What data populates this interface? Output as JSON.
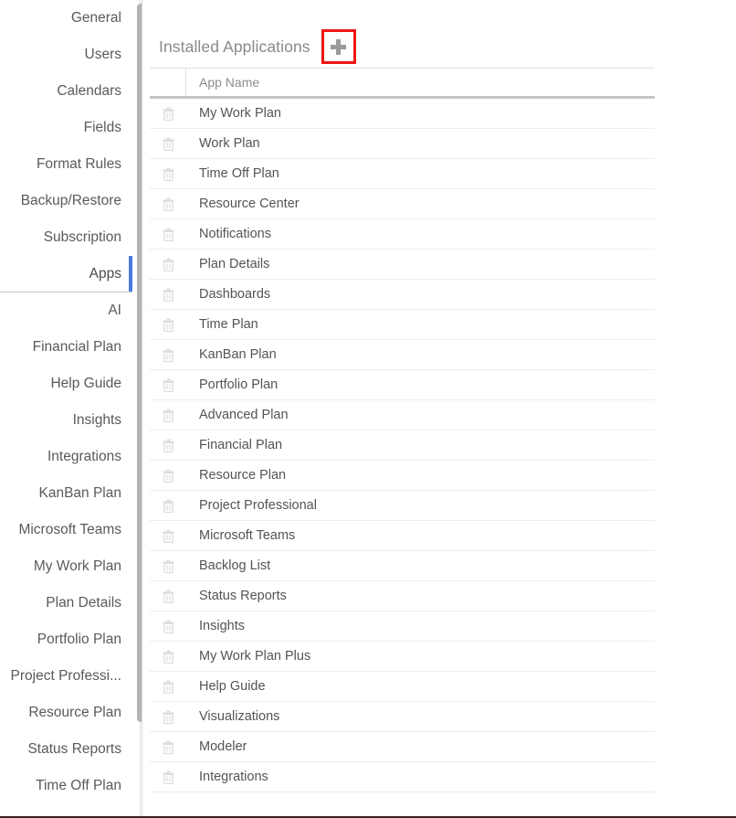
{
  "sidebar": {
    "scroll": {
      "thumb_visible": true
    },
    "items": [
      {
        "label": "General",
        "selected": false,
        "group_end": false
      },
      {
        "label": "Users",
        "selected": false,
        "group_end": false
      },
      {
        "label": "Calendars",
        "selected": false,
        "group_end": false
      },
      {
        "label": "Fields",
        "selected": false,
        "group_end": false
      },
      {
        "label": "Format Rules",
        "selected": false,
        "group_end": false
      },
      {
        "label": "Backup/Restore",
        "selected": false,
        "group_end": false
      },
      {
        "label": "Subscription",
        "selected": false,
        "group_end": false
      },
      {
        "label": "Apps",
        "selected": true,
        "group_end": true
      },
      {
        "label": "AI",
        "selected": false,
        "group_end": false
      },
      {
        "label": "Financial Plan",
        "selected": false,
        "group_end": false
      },
      {
        "label": "Help Guide",
        "selected": false,
        "group_end": false
      },
      {
        "label": "Insights",
        "selected": false,
        "group_end": false
      },
      {
        "label": "Integrations",
        "selected": false,
        "group_end": false
      },
      {
        "label": "KanBan Plan",
        "selected": false,
        "group_end": false
      },
      {
        "label": "Microsoft Teams",
        "selected": false,
        "group_end": false
      },
      {
        "label": "My Work Plan",
        "selected": false,
        "group_end": false
      },
      {
        "label": "Plan Details",
        "selected": false,
        "group_end": false
      },
      {
        "label": "Portfolio Plan",
        "selected": false,
        "group_end": false
      },
      {
        "label": "Project Professi...",
        "selected": false,
        "group_end": false
      },
      {
        "label": "Resource Plan",
        "selected": false,
        "group_end": false
      },
      {
        "label": "Status Reports",
        "selected": false,
        "group_end": false
      },
      {
        "label": "Time Off Plan",
        "selected": false,
        "group_end": false
      }
    ]
  },
  "panel": {
    "title": "Installed Applications",
    "add_button": {
      "icon": "plus-icon",
      "highlighted": true,
      "highlight_color": "#f01414"
    }
  },
  "table": {
    "columns": [
      "",
      "App Name"
    ],
    "delete_icon": "trash-icon",
    "rows": [
      {
        "name": "My Work Plan"
      },
      {
        "name": "Work Plan"
      },
      {
        "name": "Time Off Plan"
      },
      {
        "name": "Resource Center"
      },
      {
        "name": "Notifications"
      },
      {
        "name": "Plan Details"
      },
      {
        "name": "Dashboards"
      },
      {
        "name": "Time Plan"
      },
      {
        "name": "KanBan Plan"
      },
      {
        "name": "Portfolio Plan"
      },
      {
        "name": "Advanced Plan"
      },
      {
        "name": "Financial Plan"
      },
      {
        "name": "Resource Plan"
      },
      {
        "name": "Project Professional"
      },
      {
        "name": "Microsoft Teams"
      },
      {
        "name": "Backlog List"
      },
      {
        "name": "Status Reports"
      },
      {
        "name": "Insights"
      },
      {
        "name": "My Work Plan Plus"
      },
      {
        "name": "Help Guide"
      },
      {
        "name": "Visualizations"
      },
      {
        "name": "Modeler"
      },
      {
        "name": "Integrations"
      }
    ]
  },
  "colors": {
    "accent": "#4a7ddb",
    "highlight": "#f01414",
    "text": "#545454",
    "muted": "#8a8a8a"
  }
}
